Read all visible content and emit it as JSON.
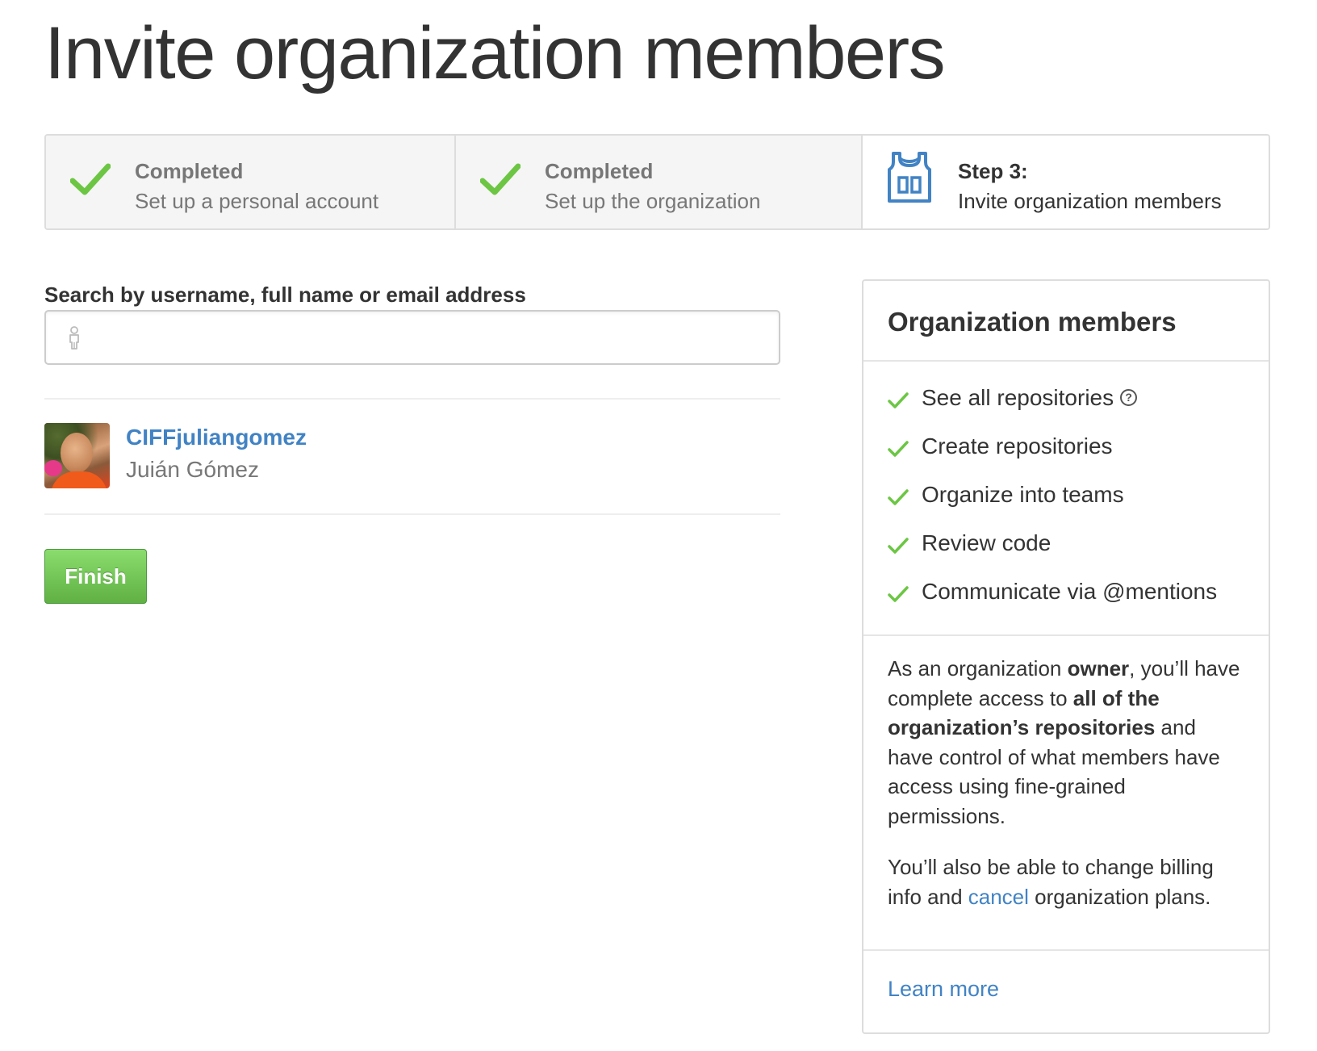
{
  "page": {
    "title": "Invite organization members"
  },
  "steps": [
    {
      "heading": "Completed",
      "label": "Set up a personal account",
      "state": "completed",
      "icon": "checkmark-icon"
    },
    {
      "heading": "Completed",
      "label": "Set up the organization",
      "state": "completed",
      "icon": "checkmark-icon"
    },
    {
      "heading": "Step 3:",
      "label": "Invite organization members",
      "state": "current",
      "icon": "jersey-icon"
    }
  ],
  "search": {
    "label": "Search by username, full name or email address",
    "value": "",
    "placeholder": "",
    "icon": "person-icon"
  },
  "members": [
    {
      "login": "CIFFjuliangomez",
      "name": "Juián Gómez",
      "avatar": "avatar-photo"
    }
  ],
  "actions": {
    "finish_label": "Finish"
  },
  "panel": {
    "title": "Organization members",
    "features": [
      "See all repositories",
      "Create repositories",
      "Organize into teams",
      "Review code",
      "Communicate via @mentions"
    ],
    "help_icon_glyph": "?",
    "info": {
      "p1_a": "As an organization ",
      "p1_b": "owner",
      "p1_c": ", you’ll have complete access to ",
      "p1_d": "all of the organization’s repositories",
      "p1_e": " and have control of what members have access using fine-grained permissions.",
      "p2_a": "You’ll also be able to change billing info and ",
      "p2_link": "cancel",
      "p2_b": " organization plans."
    },
    "learn_more": "Learn more"
  },
  "colors": {
    "check_green": "#6cc644",
    "link_blue": "#4183c4",
    "button_green": "#60b044",
    "jersey_blue": "#4183c4"
  }
}
